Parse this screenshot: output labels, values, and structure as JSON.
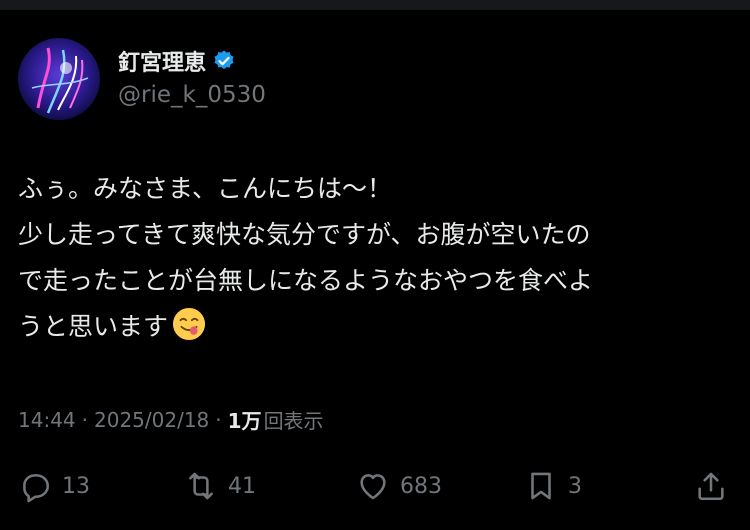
{
  "tweet": {
    "author": {
      "display_name": "釘宮理恵",
      "handle": "@rie_k_0530",
      "verified_icon": "verified-badge-icon",
      "verified_color": "#1d9bf0"
    },
    "text_lines": [
      "ふぅ。みなさま、こんにちは〜！",
      "少し走ってきて爽快な気分ですが、お腹が空いたの",
      "で走ったことが台無しになるようなおやつを食べよ",
      "うと思います"
    ],
    "emoji": "face-savoring-food-emoji",
    "meta": {
      "time": "14:44",
      "separator": "·",
      "date": "2025/02/18",
      "views_count": "1万",
      "views_label": "回表示"
    },
    "actions": {
      "replies": "13",
      "reposts": "41",
      "likes": "683",
      "bookmarks": "3"
    }
  },
  "colors": {
    "background": "#000000",
    "text_primary": "#e7e9ea",
    "text_secondary": "#71767b"
  }
}
